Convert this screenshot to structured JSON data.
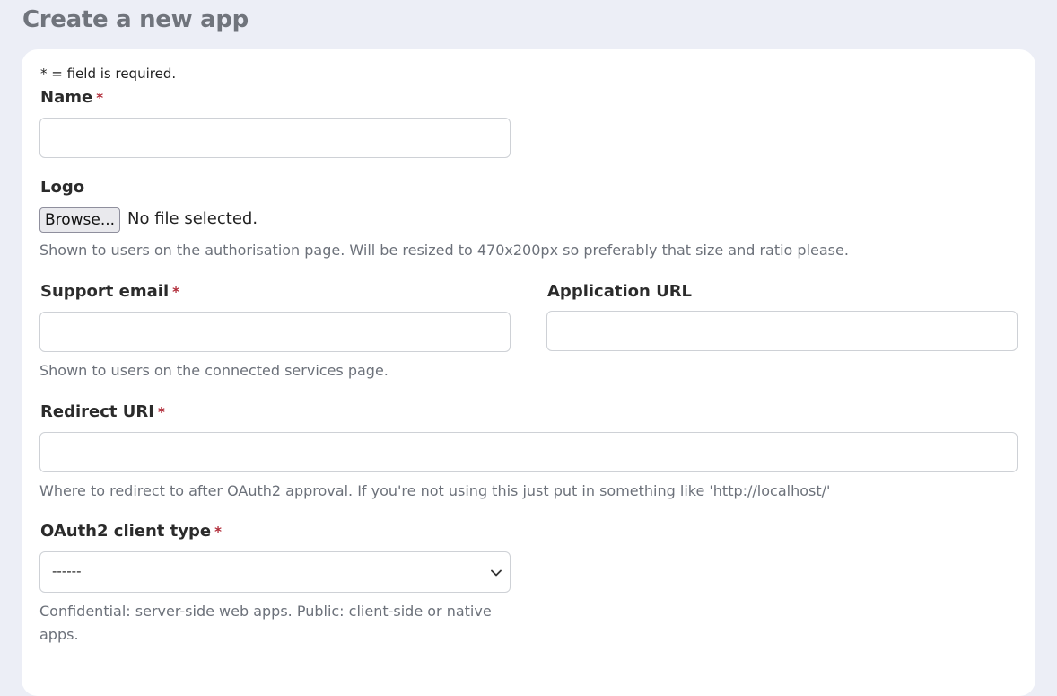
{
  "page": {
    "title": "Create a new app"
  },
  "form": {
    "required_note": "* = field is required.",
    "name": {
      "label": "Name",
      "required_marker": "*",
      "value": ""
    },
    "logo": {
      "label": "Logo",
      "browse_label": "Browse...",
      "file_status": "No file selected.",
      "help": "Shown to users on the authorisation page. Will be resized to 470x200px so preferably that size and ratio please."
    },
    "support_email": {
      "label": "Support email",
      "required_marker": "*",
      "value": "",
      "help": "Shown to users on the connected services page."
    },
    "application_url": {
      "label": "Application URL",
      "value": ""
    },
    "redirect_uri": {
      "label": "Redirect URI",
      "required_marker": "*",
      "value": "",
      "help": "Where to redirect to after OAuth2 approval. If you're not using this just put in something like 'http://localhost/'"
    },
    "client_type": {
      "label": "OAuth2 client type",
      "required_marker": "*",
      "selected": "------",
      "icon": "chevron-down-icon",
      "help": "Confidential: server-side web apps. Public: client-side or native apps."
    }
  },
  "colors": {
    "background": "#eceef6",
    "card": "#ffffff",
    "required_star": "#b02a37",
    "help_text": "#6c717a",
    "title_text": "#70747c"
  }
}
